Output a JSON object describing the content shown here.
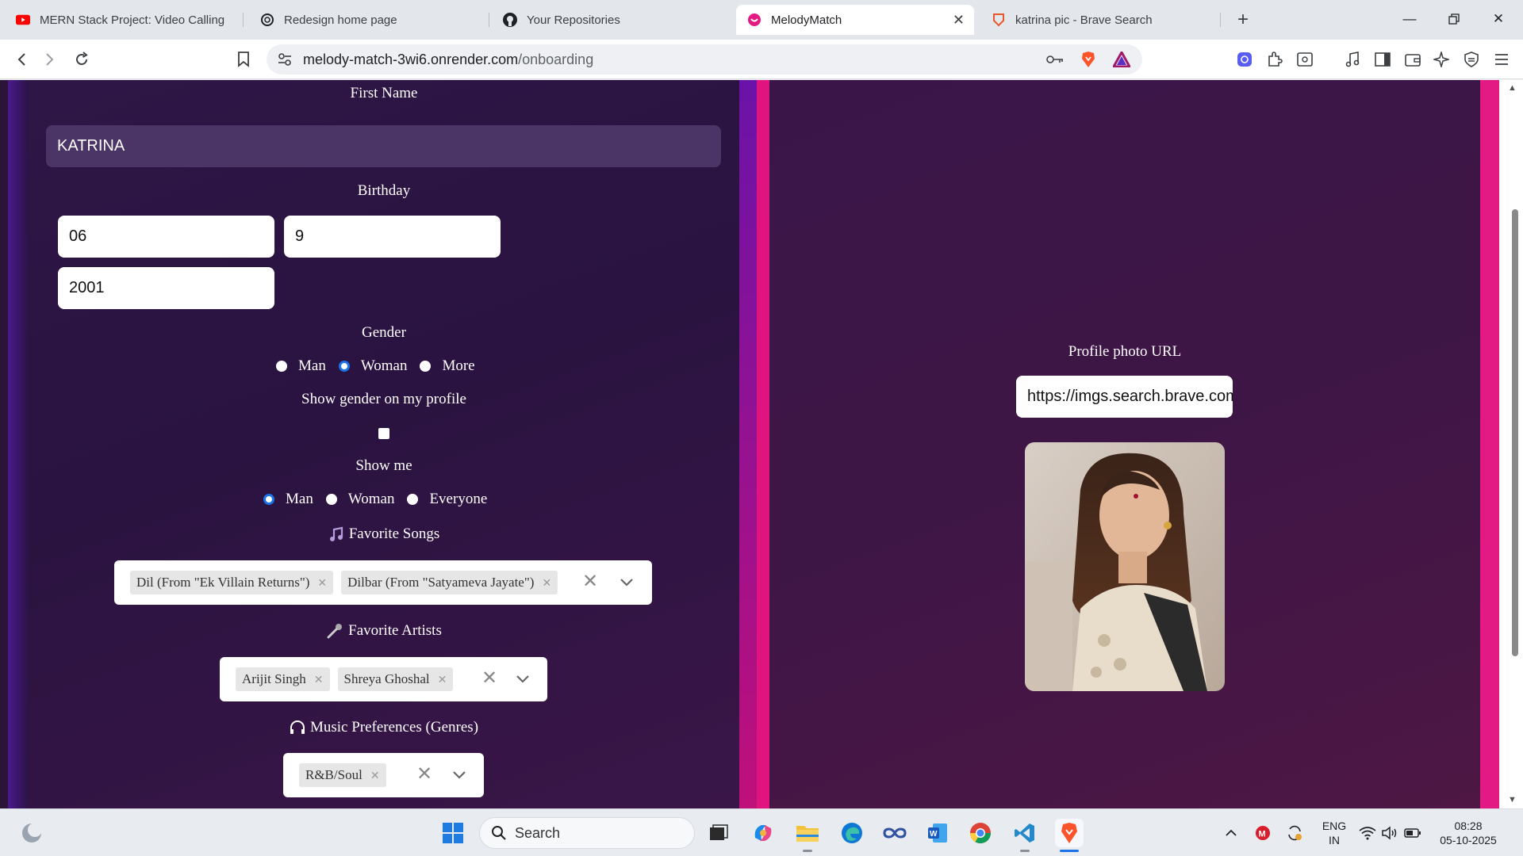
{
  "browser": {
    "tabs": [
      {
        "label": "MERN Stack Project: Video Calling Re",
        "icon": "youtube-icon"
      },
      {
        "label": "Redesign home page",
        "icon": "openai-icon"
      },
      {
        "label": "Your Repositories",
        "icon": "github-icon"
      },
      {
        "label": "MelodyMatch",
        "icon": "melodymatch-icon",
        "active": true
      },
      {
        "label": "katrina pic - Brave Search",
        "icon": "brave-search-icon"
      }
    ],
    "new_tab": "+",
    "url_host": "melody-match-3wi6.onrender.com",
    "url_path": "/onboarding"
  },
  "form": {
    "first_name_label": "First Name",
    "first_name_value": "KATRINA",
    "birthday_label": "Birthday",
    "birthday_day": "06",
    "birthday_month": "9",
    "birthday_year": "2001",
    "gender_label": "Gender",
    "gender_options": [
      "Man",
      "Woman",
      "More"
    ],
    "gender_selected": "Woman",
    "show_gender_label": "Show gender on my profile",
    "show_gender_checked": false,
    "show_me_label": "Show me",
    "show_me_options": [
      "Man",
      "Woman",
      "Everyone"
    ],
    "show_me_selected": "Man",
    "songs_label": "Favorite Songs",
    "songs": [
      "Dil (From \"Ek Villain Returns\")",
      "Dilbar (From \"Satyameva Jayate\")"
    ],
    "artists_label": "Favorite Artists",
    "artists": [
      "Arijit Singh",
      "Shreya Ghoshal"
    ],
    "genres_label": "Music Preferences (Genres)",
    "genres": [
      "R&B/Soul"
    ],
    "photo_url_label": "Profile photo URL",
    "photo_url_value": "https://imgs.search.brave.com"
  },
  "taskbar": {
    "search_placeholder": "Search",
    "language": "ENG",
    "region": "IN",
    "time": "08:28",
    "date": "05-10-2025"
  },
  "colors": {
    "accent_pink": "#e31a84",
    "accent_purple": "#6a13a8",
    "panel_dark": "#2a1340",
    "radio_checked": "#1a73e8"
  }
}
